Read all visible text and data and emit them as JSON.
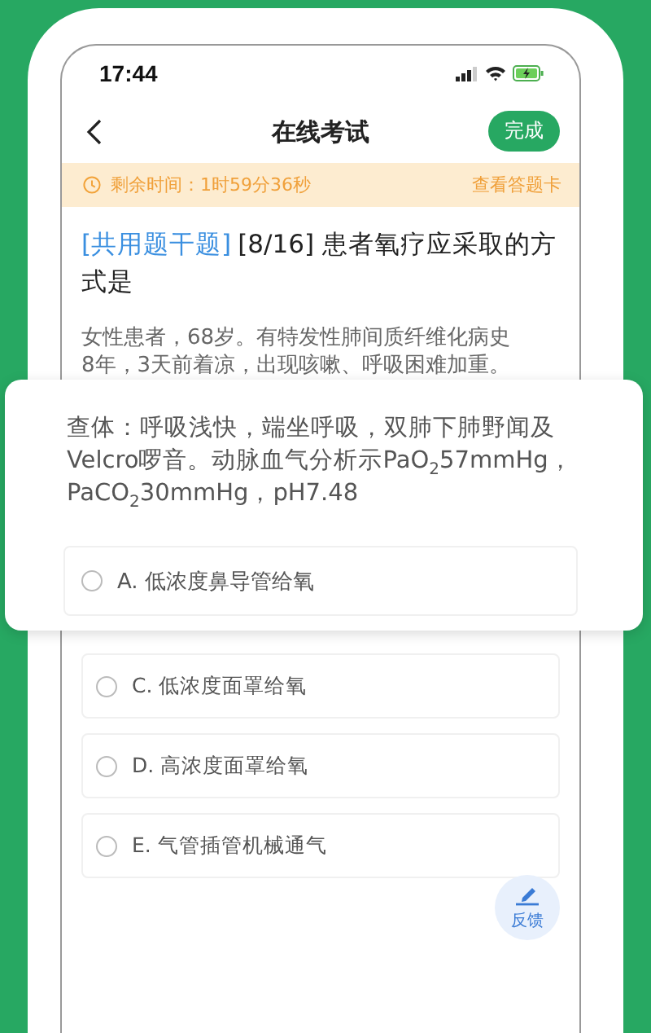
{
  "status_bar": {
    "time": "17:44"
  },
  "header": {
    "title": "在线考试",
    "done_button": "完成"
  },
  "timer_bar": {
    "remaining": "剩余时间：1时59分36秒",
    "answer_card_link": "查看答题卡"
  },
  "question": {
    "tag": "[共用题干题]",
    "stem": "[8/16] 患者氧疗应采取的方式是"
  },
  "passage": "女性患者，68岁。有特发性肺间质纤维化病史8年，3天前着凉，出现咳嗽、呼吸困难加重。",
  "options": [
    {
      "label": "C. 低浓度面罩给氧",
      "selected": false
    },
    {
      "label": "D. 高浓度面罩给氧",
      "selected": false
    },
    {
      "label": "E. 气管插管机械通气",
      "selected": false
    }
  ],
  "magnified_card": {
    "passage": "查体：呼吸浅快，端坐呼吸，双肺下肺野闻及Velcro啰音。动脉血气分析示PaO$_{2}$57mmHg，PaCO$_{2}$30mmHg，pH7.48",
    "options": [
      {
        "label": "A. 低浓度鼻导管给氧",
        "selected": false
      }
    ]
  },
  "feedback_button": "反馈"
}
